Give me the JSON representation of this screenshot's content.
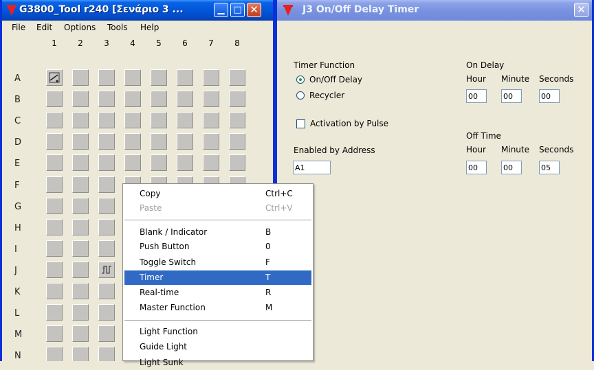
{
  "main_window": {
    "title": "G3800_Tool r240 [Σενάριο 3 ...",
    "menu": [
      "File",
      "Edit",
      "Options",
      "Tools",
      "Help"
    ],
    "columns": [
      "1",
      "2",
      "3",
      "4",
      "5",
      "6",
      "7",
      "8"
    ],
    "rows": [
      "A",
      "B",
      "C",
      "D",
      "E",
      "F",
      "G",
      "H",
      "I",
      "J",
      "K",
      "L",
      "M",
      "N"
    ],
    "cells_with_icons": [
      {
        "row": "A",
        "col": "1",
        "icon": "toggle-switch-icon"
      },
      {
        "row": "J",
        "col": "3",
        "icon": "timer-icon"
      }
    ]
  },
  "context_menu": {
    "items": [
      {
        "label": "Copy",
        "shortcut": "Ctrl+C",
        "disabled": false
      },
      {
        "label": "Paste",
        "shortcut": "Ctrl+V",
        "disabled": true
      },
      {
        "label": "Blank / Indicator",
        "shortcut": "B"
      },
      {
        "label": "Push Button",
        "shortcut": "0"
      },
      {
        "label": "Toggle Switch",
        "shortcut": "F"
      },
      {
        "label": "Timer",
        "shortcut": "T",
        "highlighted": true
      },
      {
        "label": "Real-time",
        "shortcut": "R"
      },
      {
        "label": "Master Function",
        "shortcut": "M"
      },
      {
        "label": "Light Function"
      },
      {
        "label": "Guide Light"
      },
      {
        "label": "Light Sunk"
      }
    ]
  },
  "timer_dialog": {
    "title": "J3   On/Off Delay Timer",
    "timer_function_label": "Timer Function",
    "option_onoff": "On/Off Delay",
    "option_recycler": "Recycler",
    "activation_label": "Activation by Pulse",
    "enabled_label": "Enabled by Address",
    "enabled_value": "A1",
    "on_delay": {
      "label": "On Delay",
      "hour_label": "Hour",
      "minute_label": "Minute",
      "seconds_label": "Seconds",
      "hour": "00",
      "minute": "00",
      "seconds": "00"
    },
    "off_time": {
      "label": "Off Time",
      "hour_label": "Hour",
      "minute_label": "Minute",
      "seconds_label": "Seconds",
      "hour": "00",
      "minute": "00",
      "seconds": "05"
    }
  },
  "colors": {
    "title_active": "#0a5ae0",
    "title_inactive": "#7a93e0",
    "highlight": "#316ac5"
  }
}
